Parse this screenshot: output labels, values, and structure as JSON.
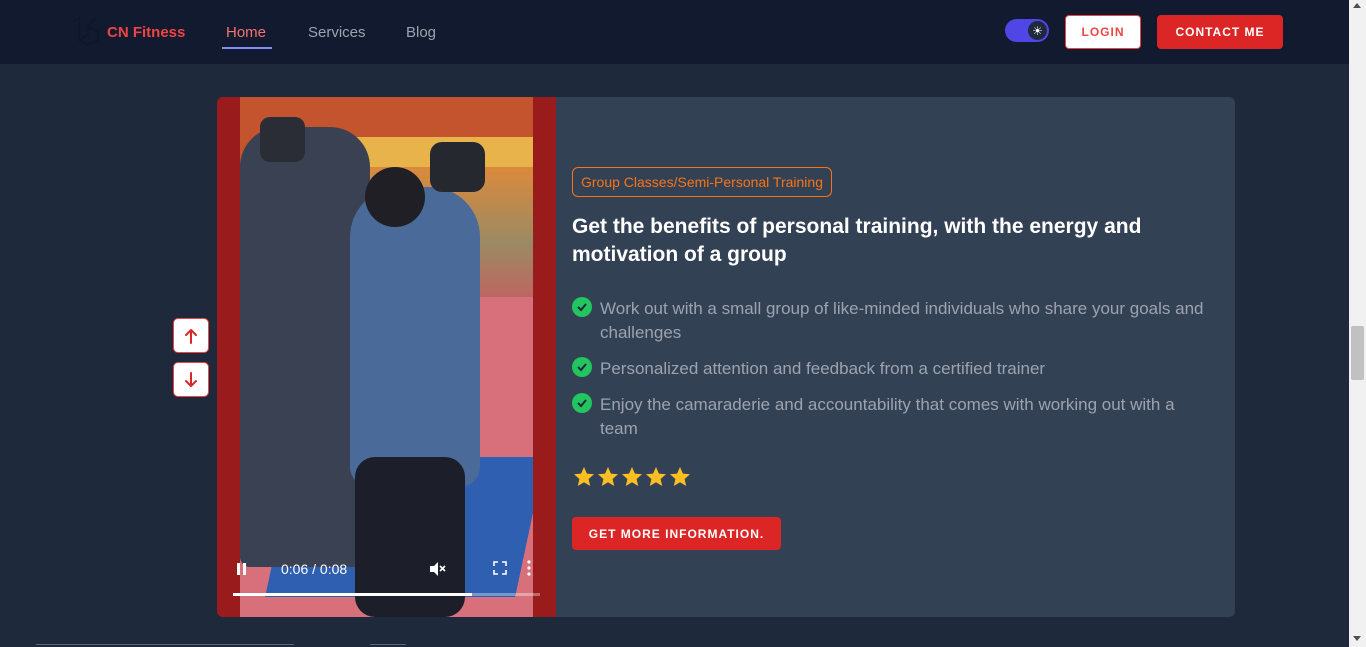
{
  "brand": {
    "name": "CN Fitness",
    "color": "#ef4444"
  },
  "nav": {
    "items": [
      {
        "label": "Home",
        "active": true
      },
      {
        "label": "Services",
        "active": false
      },
      {
        "label": "Blog",
        "active": false
      }
    ],
    "theme_toggle_icon": "sun-icon",
    "login_label": "LOGIN",
    "contact_label": "CONTACT ME"
  },
  "side_controls": {
    "up_icon": "arrow-up-icon",
    "down_icon": "arrow-down-icon"
  },
  "video": {
    "time": "0:06 / 0:08",
    "progress": 0.78,
    "muted": true,
    "state": "playing"
  },
  "card": {
    "badge": "Group Classes/Semi-Personal Training",
    "heading": "Get the benefits of personal training, with the energy and motivation of a group",
    "features": [
      "Work out with a small group of like-minded individuals who share your goals and challenges",
      "Personalized attention and feedback from a certified trainer",
      "Enjoy the camaraderie and accountability that comes with working out with a team"
    ],
    "rating": 5,
    "rating_max": 5,
    "cta_label": "GET MORE INFORMATION."
  },
  "colors": {
    "accent": "#dc2626",
    "badge": "#f97316",
    "check": "#22c55e",
    "star": "#fbbf24",
    "card_bg": "#334155",
    "page_bg": "#1e293b",
    "nav_bg": "#111a2e"
  }
}
